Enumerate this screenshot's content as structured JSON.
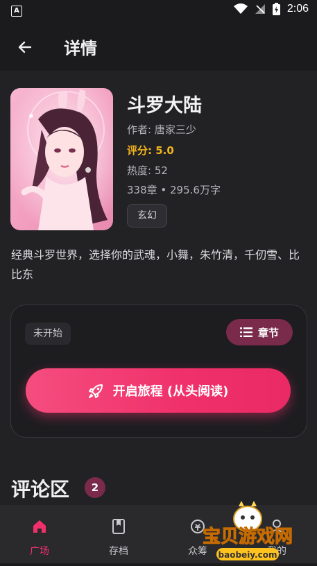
{
  "status_bar": {
    "time": "2:06",
    "notification_glyph": "A"
  },
  "header": {
    "title": "详情"
  },
  "book": {
    "title": "斗罗大陆",
    "author": "作者: 唐家三少",
    "rating": "评分: 5.0",
    "popularity": "热度: 52",
    "stats": "338章 • 295.6万字",
    "genre": "玄幻",
    "description": "经典斗罗世界，选择你的武魂，小舞，朱竹清，千仞雪、比比东"
  },
  "progress_card": {
    "status": "未开始",
    "chapters_label": "章节",
    "start_label": "开启旅程 (从头阅读)"
  },
  "comments": {
    "title": "评论区",
    "count": "2"
  },
  "bottom_nav": [
    {
      "label": "广场",
      "icon": "home-icon",
      "active": true
    },
    {
      "label": "存档",
      "icon": "bookmark-book-icon",
      "active": false
    },
    {
      "label": "众筹",
      "icon": "crowdfund-icon",
      "active": false
    },
    {
      "label": "我的",
      "icon": "profile-icon",
      "active": false
    }
  ],
  "watermark": {
    "text": "宝贝游戏网",
    "url_text": "baobeiy.com"
  },
  "colors": {
    "accent": "#f0306a",
    "rating": "#f2b41c",
    "chip_accent": "#7a2a4b",
    "background": "#1b1b1d"
  }
}
